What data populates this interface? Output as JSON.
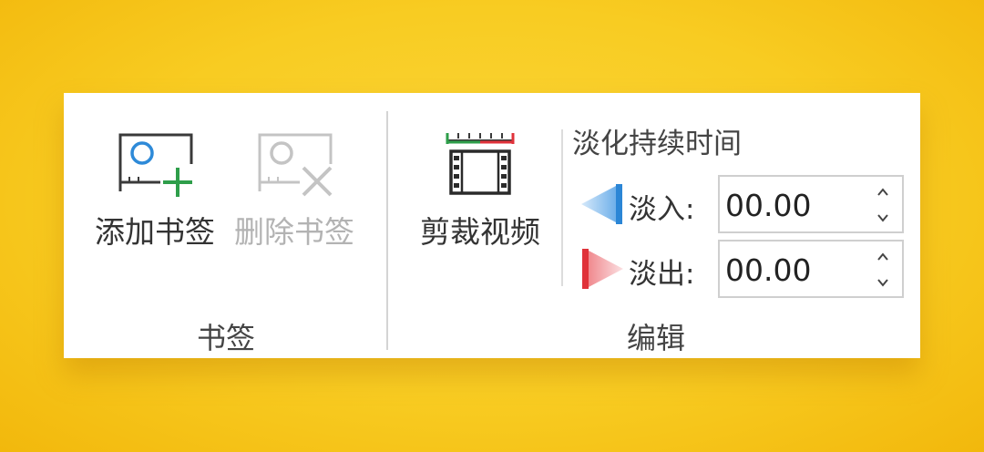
{
  "ribbon": {
    "bookmark_group": {
      "label": "书签",
      "add_bookmark": {
        "label": "添加书签",
        "icon": "add-bookmark-icon",
        "enabled": true
      },
      "delete_bookmark": {
        "label": "删除书签",
        "icon": "delete-bookmark-icon",
        "enabled": false
      }
    },
    "edit_group": {
      "label": "编辑",
      "trim_video": {
        "label": "剪裁视频",
        "icon": "trim-video-icon"
      },
      "fade_duration": {
        "title": "淡化持续时间",
        "fade_in": {
          "label": "淡入:",
          "value": "00.00",
          "icon": "fade-in-icon"
        },
        "fade_out": {
          "label": "淡出:",
          "value": "00.00",
          "icon": "fade-out-icon"
        }
      }
    }
  },
  "colors": {
    "add_plus": "#2e9e4a",
    "bookmark_circle": "#2e8ad8",
    "fade_in": "#2b86d6",
    "fade_out": "#e0323a",
    "timeline_green": "#2e9e4a",
    "timeline_red": "#e0323a"
  }
}
